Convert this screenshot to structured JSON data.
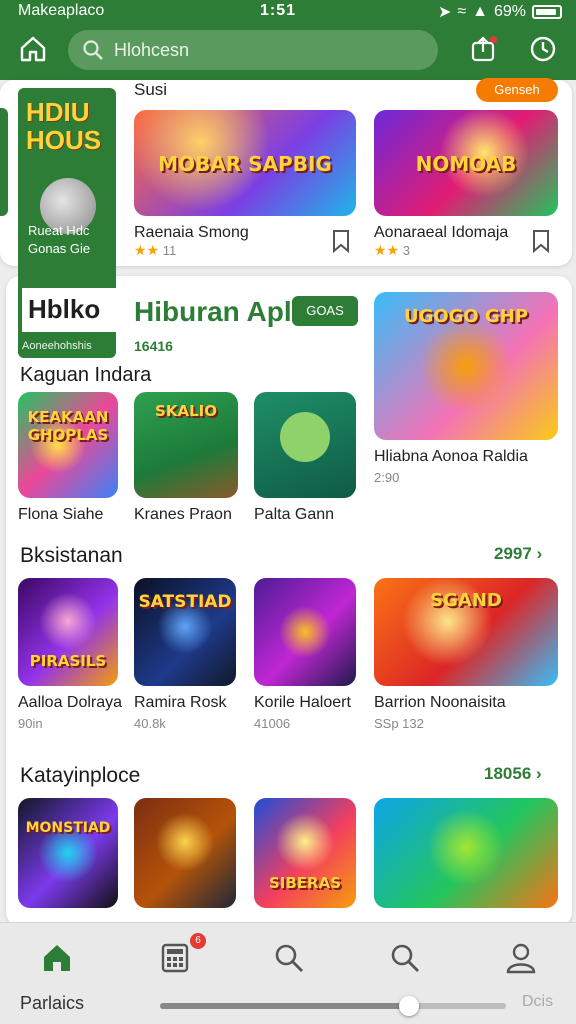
{
  "status_bar": {
    "carrier": "Makeaplaco",
    "time": "1:51",
    "battery": "69%"
  },
  "header": {
    "search_placeholder": "Hlohcesn"
  },
  "top_section": {
    "label": "Susi",
    "pill": "Genseh",
    "promo": {
      "title": "HDIU HOUS",
      "caption_line1": "Rueat Hdc",
      "caption_line2": "Gonas Gie"
    },
    "items": [
      {
        "title": "Raenaia Smong",
        "rating": "11",
        "art_text": "MOBAR SAPBIG"
      },
      {
        "title": "Aonaraeal Idomaja",
        "rating": "3",
        "art_text": "NOMOAB"
      }
    ]
  },
  "featured": {
    "logo_text": "Hblko",
    "logo_sub": "Aoneehohshis",
    "title": "Hiburan Apl",
    "badge": "GOAS",
    "count": "16416",
    "category": "Kaguan Indara",
    "hero": {
      "title": "Hliabna Aonoa Raldia",
      "sub": "2:90",
      "art_text": "UGOGO GHP"
    },
    "apps": [
      {
        "name": "Flona Siahe",
        "art_text": "KEAKAAN GHOPLAS"
      },
      {
        "name": "Kranes Praon",
        "art_text": "SKALIO"
      },
      {
        "name": "Palta Gann",
        "art_text": ""
      }
    ]
  },
  "section2": {
    "title": "Bksistanan",
    "more": "2997",
    "items": [
      {
        "name": "Aalloa Dolraya",
        "sub": "90in",
        "art_text": "PIRASILS"
      },
      {
        "name": "Ramira Rosk",
        "sub": "40.8k",
        "art_text": "SATSTIAD"
      },
      {
        "name": "Korile Haloert",
        "sub": "41006",
        "art_text": ""
      },
      {
        "name": "Barrion Noonaisita",
        "sub": "SSp 132",
        "art_text": "SGAND"
      }
    ]
  },
  "section3": {
    "title": "Katayinploce",
    "more": "18056",
    "items": [
      {
        "art_text": "MONSTIAD"
      },
      {
        "art_text": ""
      },
      {
        "art_text": "SIBERAS"
      },
      {
        "art_text": ""
      }
    ]
  },
  "bottom_nav": {
    "badge": "6",
    "left_label": "Parlaics",
    "right_label": "Dcis",
    "slider_value": 0.72
  }
}
